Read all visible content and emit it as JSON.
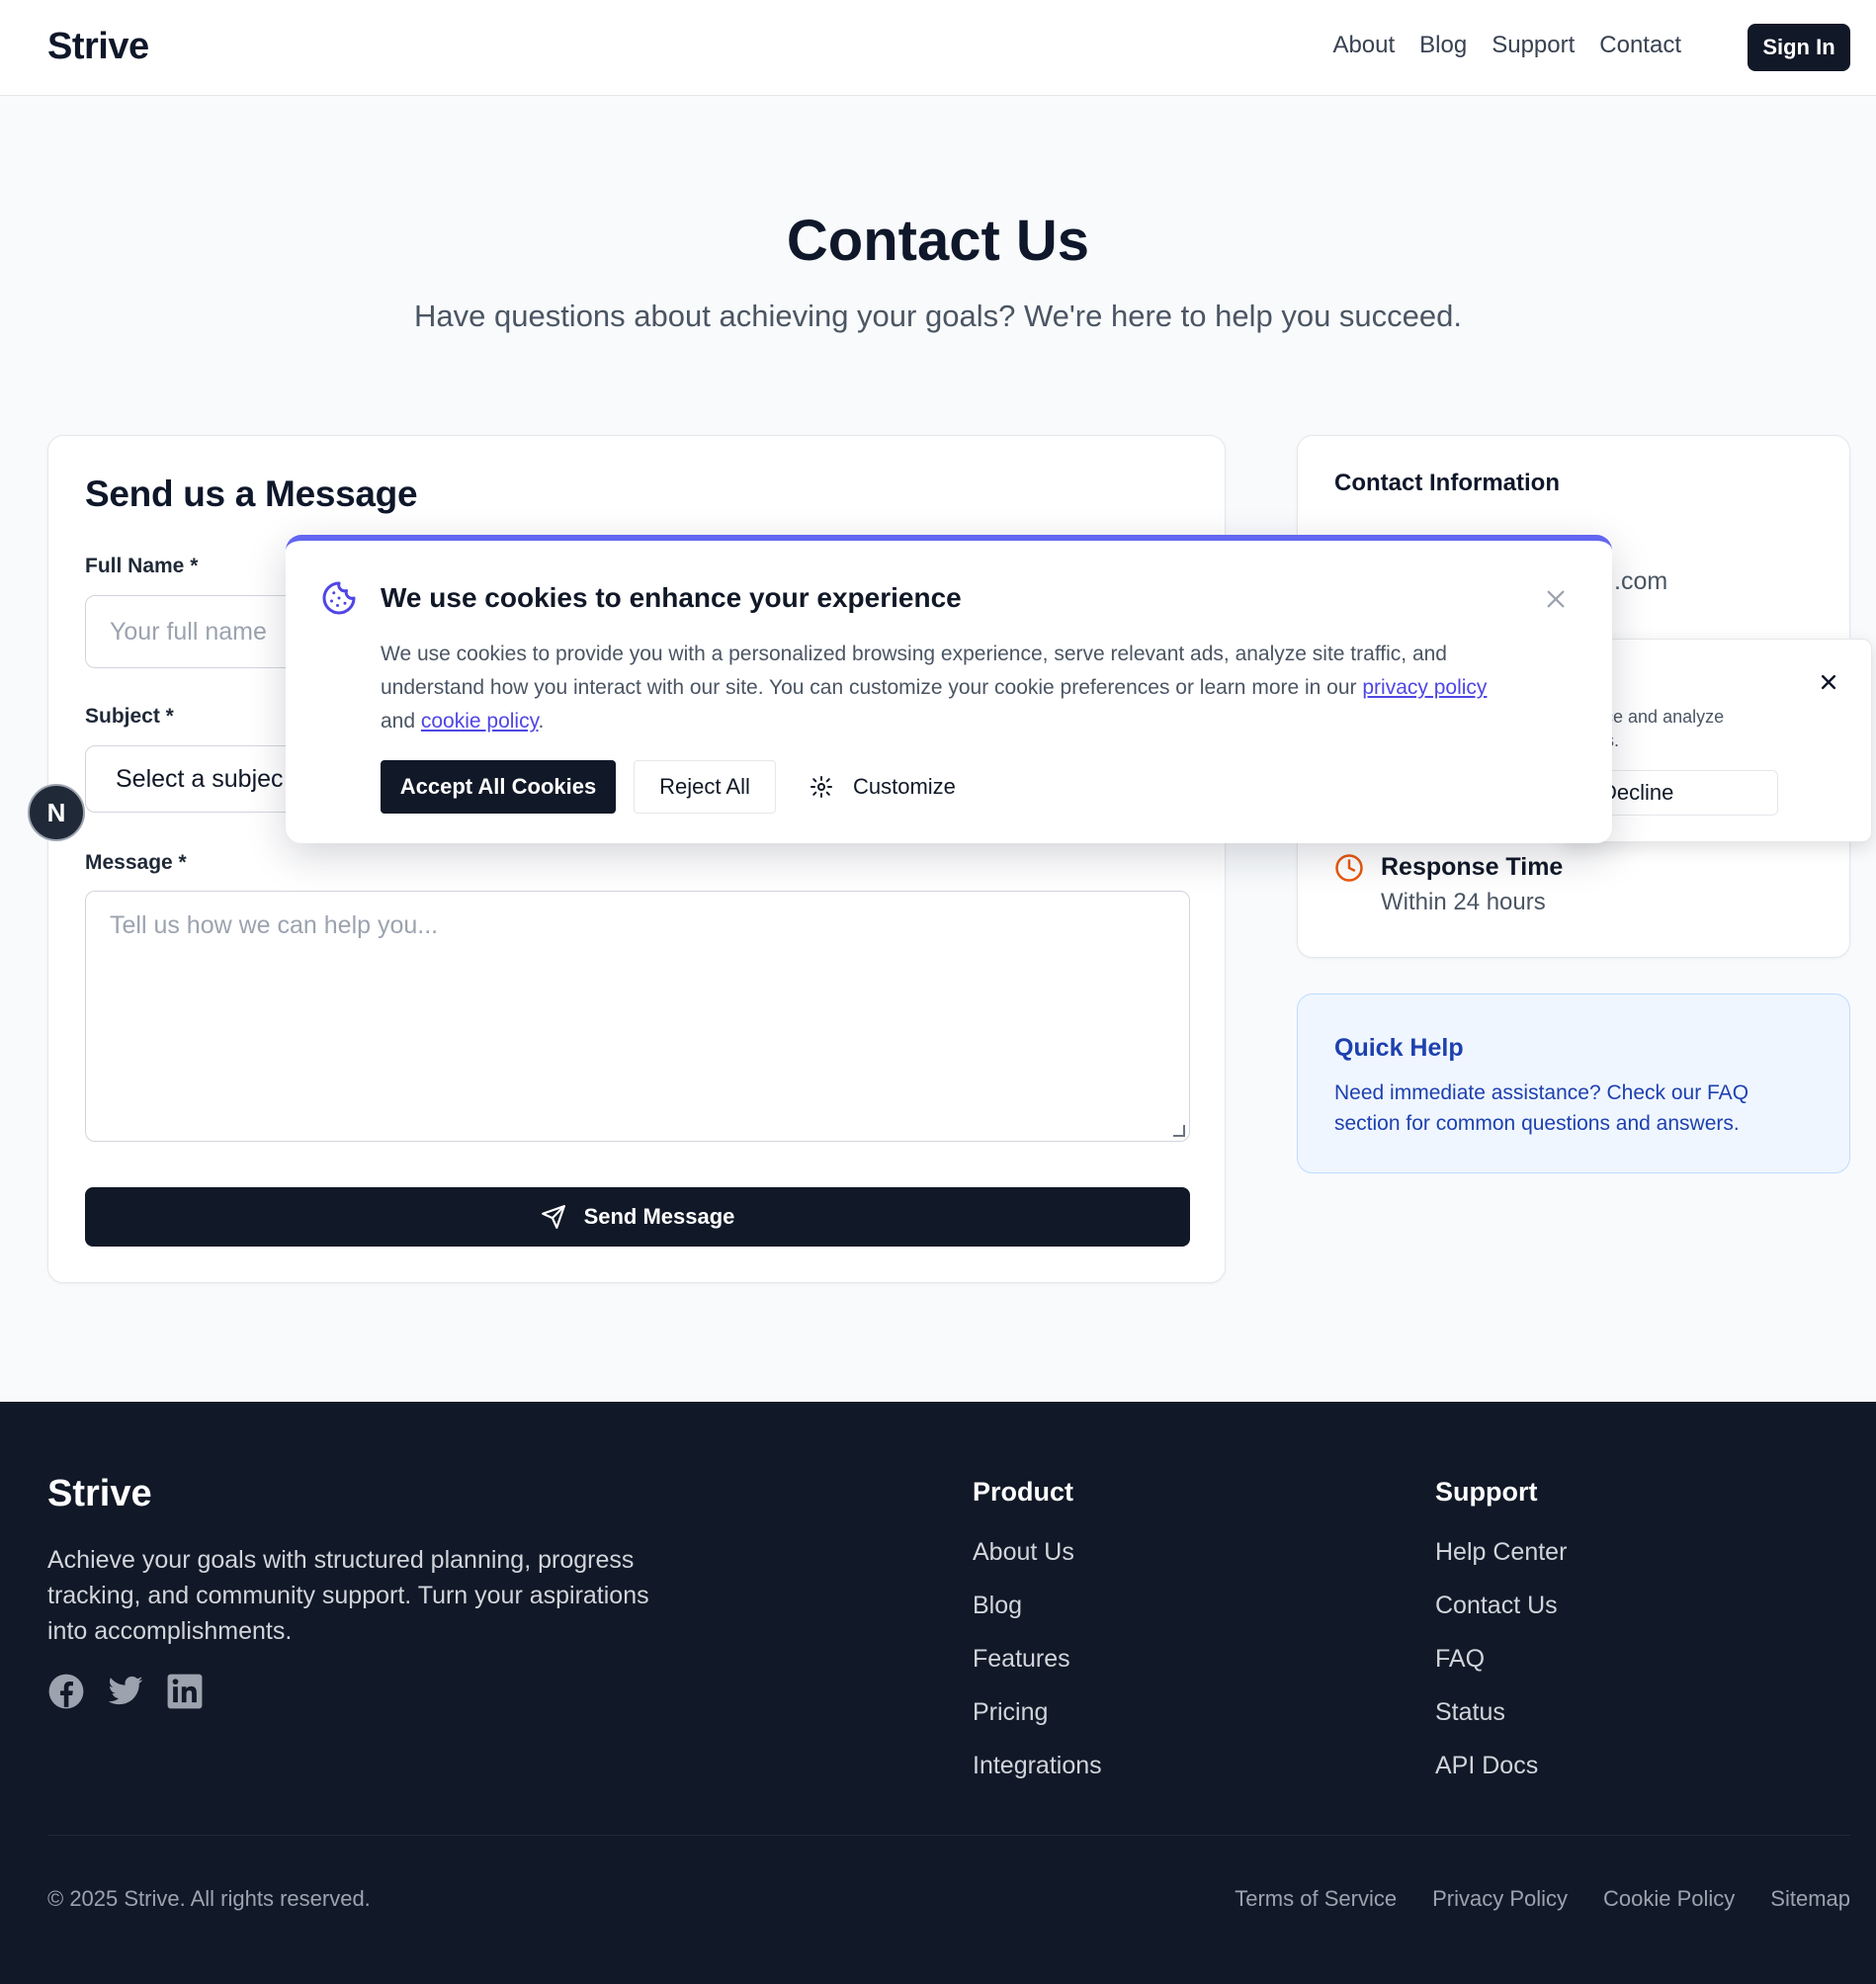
{
  "header": {
    "brand": "Strive",
    "nav": [
      "About",
      "Blog",
      "Support",
      "Contact"
    ],
    "sign_in": "Sign In"
  },
  "hero": {
    "title": "Contact Us",
    "subtitle": "Have questions about achieving your goals? We're here to help you succeed."
  },
  "form": {
    "title": "Send us a Message",
    "full_name_label": "Full Name *",
    "full_name_placeholder": "Your full name",
    "subject_label": "Subject *",
    "subject_value": "Select a subjec",
    "message_label": "Message *",
    "message_placeholder": "Tell us how we can help you...",
    "send_label": "Send Message"
  },
  "contact_info": {
    "title": "Contact Information",
    "email_tail": ".com",
    "response_title": "Response Time",
    "response_value": "Within 24 hours"
  },
  "quick_help": {
    "title": "Quick Help",
    "text": "Need immediate assistance? Check our FAQ section for common questions and answers."
  },
  "avatar": {
    "letter": "N"
  },
  "cookie_secondary": {
    "text_line1": "ience and analyze",
    "text_line2": "o us.",
    "decline": "Decline"
  },
  "cookie_banner": {
    "title": "We use cookies to enhance your experience",
    "text_before": "We use cookies to provide you with a personalized browsing experience, serve relevant ads, analyze site traffic, and understand how you interact with our site. You can customize your cookie preferences or learn more in our ",
    "privacy_link": "privacy policy",
    "and": " and ",
    "cookie_link": "cookie policy",
    "period": ".",
    "accept": "Accept All Cookies",
    "reject": "Reject All",
    "customize": "Customize",
    "accent_color": "#6366f1"
  },
  "footer": {
    "brand": "Strive",
    "description": "Achieve your goals with structured planning, progress tracking, and community support. Turn your aspirations into accomplishments.",
    "product_title": "Product",
    "product_links": [
      "About Us",
      "Blog",
      "Features",
      "Pricing",
      "Integrations"
    ],
    "support_title": "Support",
    "support_links": [
      "Help Center",
      "Contact Us",
      "FAQ",
      "Status",
      "API Docs"
    ],
    "copyright": "© 2025 Strive. All rights reserved.",
    "legal": [
      "Terms of Service",
      "Privacy Policy",
      "Cookie Policy",
      "Sitemap"
    ],
    "social_icons": [
      "facebook-icon",
      "twitter-icon",
      "linkedin-icon"
    ]
  }
}
